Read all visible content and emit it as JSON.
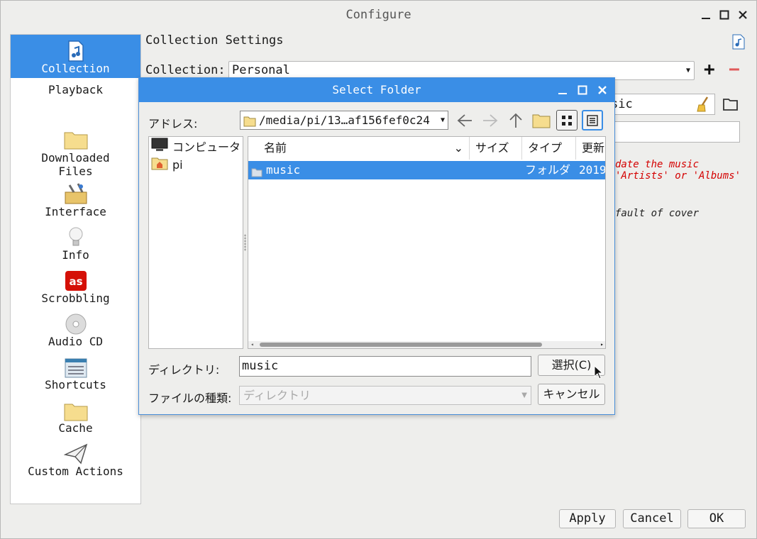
{
  "window": {
    "title": "Configure"
  },
  "sidebar": {
    "items": [
      {
        "label": "Collection",
        "icon": "music-file-icon",
        "selected": true
      },
      {
        "label": "Playback",
        "icon": "",
        "selected": false
      },
      {
        "label": "Downloaded Files",
        "icon": "folder-icon",
        "selected": false
      },
      {
        "label": "Interface",
        "icon": "toolbox-icon",
        "selected": false
      },
      {
        "label": "Info",
        "icon": "lightbulb-icon",
        "selected": false
      },
      {
        "label": "Scrobbling",
        "icon": "lastfm-icon",
        "selected": false
      },
      {
        "label": "Audio CD",
        "icon": "cd-icon",
        "selected": false
      },
      {
        "label": "Shortcuts",
        "icon": "shortcuts-icon",
        "selected": false
      },
      {
        "label": "Cache",
        "icon": "folder-icon",
        "selected": false
      },
      {
        "label": "Custom Actions",
        "icon": "paper-plane-icon",
        "selected": false
      }
    ]
  },
  "main": {
    "header_title": "Collection Settings",
    "collection_label": "Collection:",
    "collection_value": "Personal",
    "bg_field_value": "sic",
    "red_note_line1": "date the music",
    "red_note_line2": "'Artists' or 'Albums'",
    "grey_note": "fault of cover"
  },
  "buttons": {
    "apply": "Apply",
    "cancel": "Cancel",
    "ok": "OK"
  },
  "dialog": {
    "title": "Select Folder",
    "address_label": "アドレス:",
    "address_value": "/media/pi/13…af156fef0c24",
    "places": [
      {
        "label": "コンピュータ",
        "icon": "computer-icon"
      },
      {
        "label": "pi",
        "icon": "home-folder-icon"
      }
    ],
    "columns": [
      "名前",
      "サイズ",
      "タイプ",
      "更新日"
    ],
    "rows": [
      {
        "name": "music",
        "size": "",
        "type": "フォルダ",
        "modified": "2019"
      }
    ],
    "directory_label": "ディレクトリ:",
    "directory_value": "music",
    "filetype_label": "ファイルの種類:",
    "filetype_value": "ディレクトリ",
    "select_button": "選択(C)",
    "cancel_button": "キャンセル"
  },
  "colors": {
    "accent": "#3a8ee6",
    "remove": "#e05a5a",
    "warning": "#d40000"
  }
}
